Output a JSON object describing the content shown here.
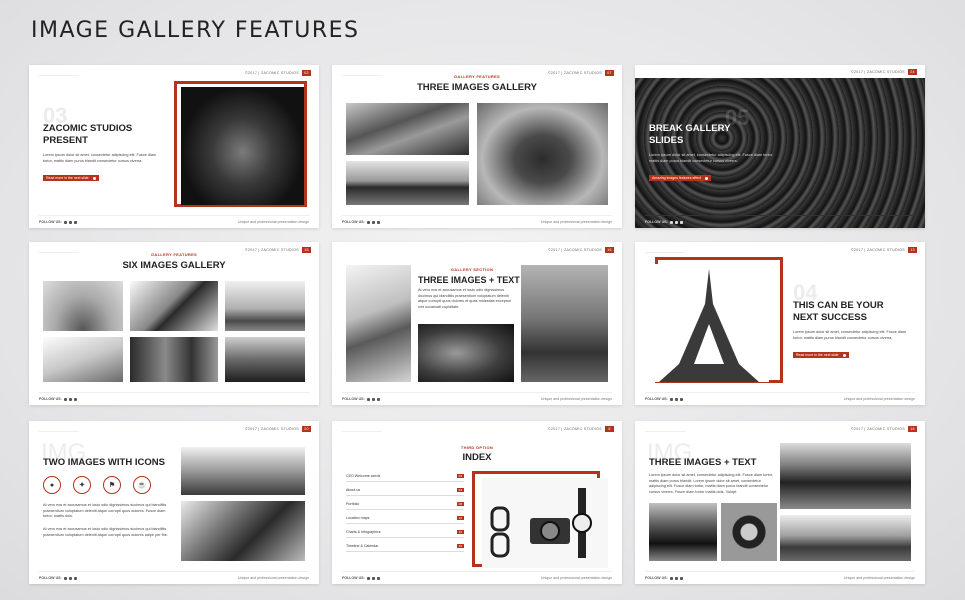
{
  "page_title": "IMAGE GALLERY FEATURES",
  "copyright": "©2017 | ZACOMIC STUDIOS",
  "follow": "FOLLOW US:",
  "tagline": "Unique and professional presentation design",
  "slides": [
    {
      "page": "02",
      "number": "03",
      "title_l1": "ZACOMIC STUDIOS",
      "title_l2": "PRESENT",
      "body": "Lorem ipsum dolor sit amet, consectetur adipiscing elit. Fusce diam tortor, mattis diam purus blandit consectetur cursus viverra.",
      "button": "Read more in the next slide"
    },
    {
      "page": "07",
      "label": "GALLERY FEATURES",
      "title": "THREE IMAGES GALLERY"
    },
    {
      "page": "24",
      "number": "05",
      "title_l1": "BREAK GALLERY",
      "title_l2": "SLIDES",
      "body": "Lorem ipsum dolor sit amet, consectetur adipiscing elit. Fusce diam tortor, mattis diam purus blandit consectetur cursus viverra.",
      "button": "Amazing images features effect"
    },
    {
      "page": "15",
      "label": "GALLERY FEATURES",
      "title": "SIX IMAGES GALLERY"
    },
    {
      "page": "16",
      "label": "GALLERY SECTION",
      "title": "THREE IMAGES + TEXT",
      "body": "At vero eos et accusamus et iusto odio dignissimos ducimus qui blanditiis praesentium voluptatum deleniti atque corrupti quos dolores et quas molestias excepturi sint occaecati cupiditate."
    },
    {
      "page": "13",
      "number": "04",
      "title_l1": "THIS CAN BE YOUR",
      "title_l2": "NEXT SUCCESS",
      "body": "Lorem ipsum dolor sit amet, consectetur adipiscing elit. Fusce diam tortor, mattis diam purus blandit consectetur cursus viverra.",
      "button": "Read more in the next slide"
    },
    {
      "page": "20",
      "bg_word": "IMG",
      "title": "TWO IMAGES WITH ICONS",
      "body1": "At vero eos et accusamus et iusto odio dignissimos ducimus qui blanditiis praesentium voluptatum deleniti atque corrupti quos dolores. Fusce diam tortor, mattis dols.",
      "body2": "At vero eos et accusamus et iusto odio dignissimos ducimus qui blanditiis praesentium voluptatum deleniti atque corrupti quos dolores adipe per the."
    },
    {
      "page": "8",
      "label": "THIRD OPTION",
      "title": "INDEX",
      "items": [
        {
          "text": "CEO Welcome words",
          "n": "03"
        },
        {
          "text": "About us",
          "n": "04"
        },
        {
          "text": "Portfolio",
          "n": "08"
        },
        {
          "text": "Location maps",
          "n": "12"
        },
        {
          "text": "Charts & Infographics",
          "n": "15"
        },
        {
          "text": "Timeline & Calendar",
          "n": "19"
        }
      ]
    },
    {
      "page": "18",
      "bg_word": "IMG",
      "title": "THREE IMAGES + TEXT",
      "body": "Lorem ipsum dolor sit amet, consectetur adipiscing elit. Fusce diam tortor, mattis diam purus blandit. Lorem ipsum dolor sit amet, consectetur adipiscing elit. Fusce diam tortor, mattis diam purus blandit consectetur cursus viverra. Fusce diam tortor mattis dols. Vulupt."
    }
  ],
  "icons": {
    "c1": "●",
    "c2": "✦",
    "c3": "⚑",
    "c4": "☕"
  }
}
